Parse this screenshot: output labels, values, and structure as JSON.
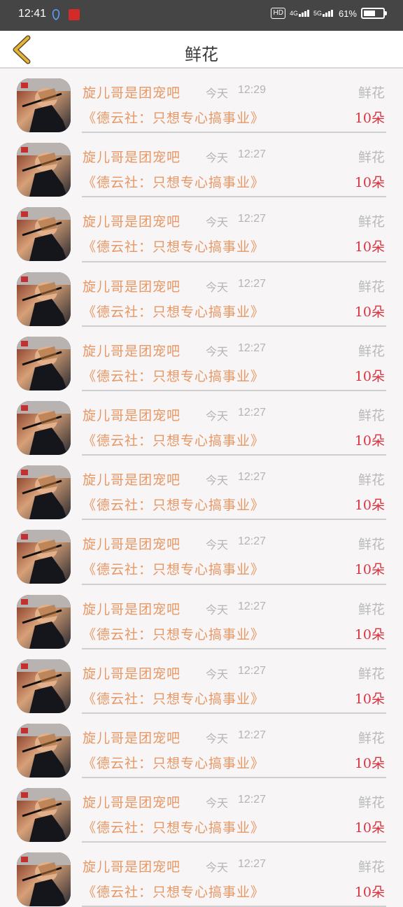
{
  "status_bar": {
    "time": "12:41",
    "hd": "HD",
    "net1": "4G",
    "net2": "5G",
    "battery_percent": "61%",
    "battery_level": 0.61
  },
  "header": {
    "title": "鲜花"
  },
  "records": [
    {
      "user": "旋儿哥是团宠吧",
      "day": "今天",
      "time": "12:29",
      "gift": "鲜花",
      "message": "《德云社：只想专心搞事业》",
      "count": "10朵"
    },
    {
      "user": "旋儿哥是团宠吧",
      "day": "今天",
      "time": "12:27",
      "gift": "鲜花",
      "message": "《德云社：只想专心搞事业》",
      "count": "10朵"
    },
    {
      "user": "旋儿哥是团宠吧",
      "day": "今天",
      "time": "12:27",
      "gift": "鲜花",
      "message": "《德云社：只想专心搞事业》",
      "count": "10朵"
    },
    {
      "user": "旋儿哥是团宠吧",
      "day": "今天",
      "time": "12:27",
      "gift": "鲜花",
      "message": "《德云社：只想专心搞事业》",
      "count": "10朵"
    },
    {
      "user": "旋儿哥是团宠吧",
      "day": "今天",
      "time": "12:27",
      "gift": "鲜花",
      "message": "《德云社：只想专心搞事业》",
      "count": "10朵"
    },
    {
      "user": "旋儿哥是团宠吧",
      "day": "今天",
      "time": "12:27",
      "gift": "鲜花",
      "message": "《德云社：只想专心搞事业》",
      "count": "10朵"
    },
    {
      "user": "旋儿哥是团宠吧",
      "day": "今天",
      "time": "12:27",
      "gift": "鲜花",
      "message": "《德云社：只想专心搞事业》",
      "count": "10朵"
    },
    {
      "user": "旋儿哥是团宠吧",
      "day": "今天",
      "time": "12:27",
      "gift": "鲜花",
      "message": "《德云社：只想专心搞事业》",
      "count": "10朵"
    },
    {
      "user": "旋儿哥是团宠吧",
      "day": "今天",
      "time": "12:27",
      "gift": "鲜花",
      "message": "《德云社：只想专心搞事业》",
      "count": "10朵"
    },
    {
      "user": "旋儿哥是团宠吧",
      "day": "今天",
      "time": "12:27",
      "gift": "鲜花",
      "message": "《德云社：只想专心搞事业》",
      "count": "10朵"
    },
    {
      "user": "旋儿哥是团宠吧",
      "day": "今天",
      "time": "12:27",
      "gift": "鲜花",
      "message": "《德云社：只想专心搞事业》",
      "count": "10朵"
    },
    {
      "user": "旋儿哥是团宠吧",
      "day": "今天",
      "time": "12:27",
      "gift": "鲜花",
      "message": "《德云社：只想专心搞事业》",
      "count": "10朵"
    },
    {
      "user": "旋儿哥是团宠吧",
      "day": "今天",
      "time": "12:27",
      "gift": "鲜花",
      "message": "《德云社：只想专心搞事业》",
      "count": "10朵"
    }
  ],
  "colors": {
    "accent_orange": "#e79764",
    "count_red": "#d9333f",
    "muted_gray": "#b4b4b4",
    "back_arrow": "#e5b43a",
    "status_bar_bg": "#454545"
  }
}
